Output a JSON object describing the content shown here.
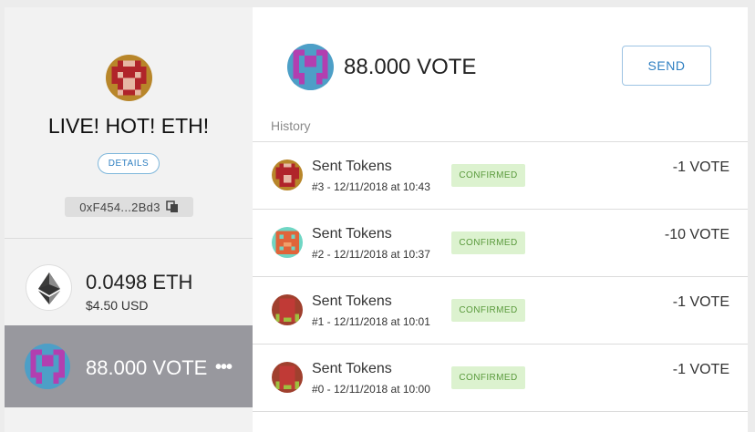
{
  "account": {
    "name": "LIVE! HOT! ETH!",
    "details_label": "DETAILS",
    "address": "0xF454...2Bd3"
  },
  "tokens": [
    {
      "symbol_balance": "0.0498 ETH",
      "usd": "$4.50 USD",
      "icon": "ethereum-icon"
    },
    {
      "symbol_balance": "88.000 VOTE",
      "more": "•••",
      "icon": "vote-token-identicon",
      "selected": true
    }
  ],
  "main": {
    "balance": "88.000 VOTE",
    "send_label": "SEND",
    "history_label": "History"
  },
  "history": [
    {
      "title": "Sent Tokens",
      "sub": "#3 - 12/11/2018 at 10:43",
      "status": "CONFIRMED",
      "amount": "-1 VOTE"
    },
    {
      "title": "Sent Tokens",
      "sub": "#2 - 12/11/2018 at 10:37",
      "status": "CONFIRMED",
      "amount": "-10 VOTE"
    },
    {
      "title": "Sent Tokens",
      "sub": "#1 - 12/11/2018 at 10:01",
      "status": "CONFIRMED",
      "amount": "-1 VOTE"
    },
    {
      "title": "Sent Tokens",
      "sub": "#0 - 12/11/2018 at 10:00",
      "status": "CONFIRMED",
      "amount": "-1 VOTE"
    }
  ],
  "colors": {
    "accent_blue": "#2f7fc1",
    "confirmed_bg": "#dcf2cf",
    "confirmed_text": "#5a9a3c",
    "selected_row": "#98989e"
  }
}
